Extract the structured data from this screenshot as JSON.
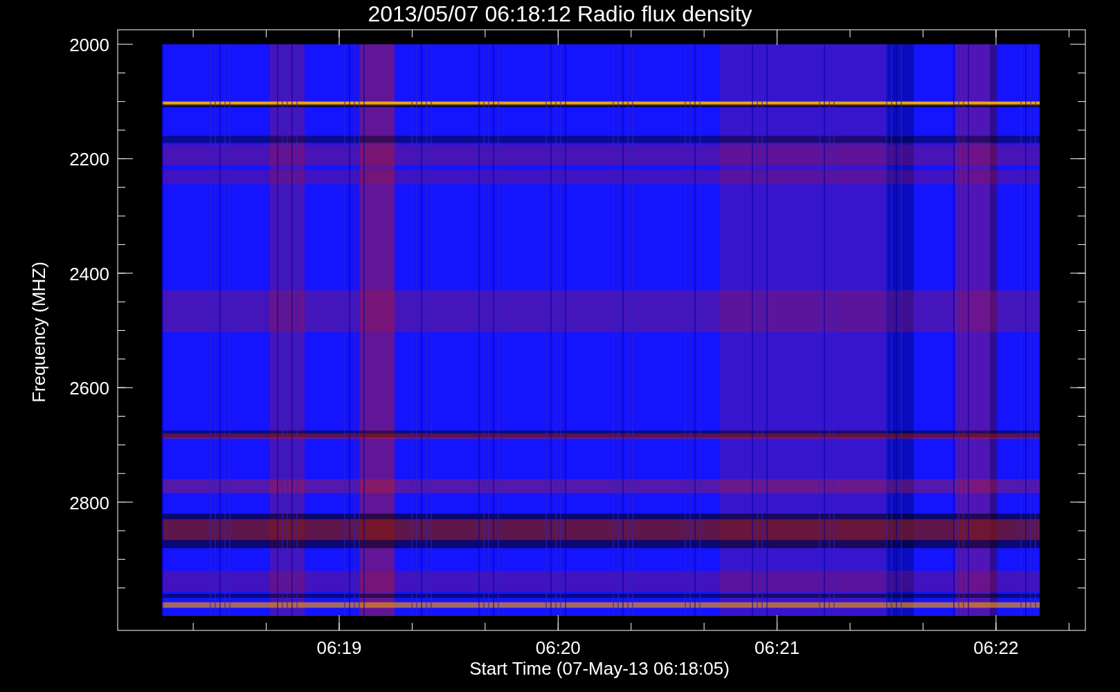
{
  "title": "2013/05/07 06:18:12 Radio flux density",
  "y_axis": {
    "label": "Frequency (MHZ)",
    "ticks": [
      "2000",
      "2200",
      "2400",
      "2600",
      "2800"
    ]
  },
  "x_axis": {
    "label": "Start Time (07-May-13 06:18:05)",
    "ticks": [
      "06:19",
      "06:20",
      "06:21",
      "06:22"
    ]
  }
}
